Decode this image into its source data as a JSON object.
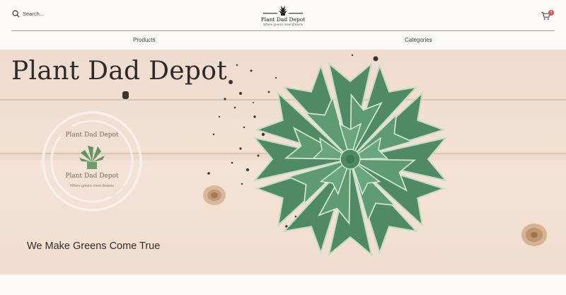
{
  "search": {
    "placeholder": "Search..."
  },
  "logo": {
    "name": "Plant Dad Depot",
    "tagline": "Where greens meet dreams"
  },
  "cart": {
    "count": "1"
  },
  "nav": {
    "products": "Products",
    "categories": "Categories"
  },
  "hero": {
    "title": "Plant Dad Depot",
    "tagline": "We Make Greens Come True",
    "badge_tagline": "Where greens meet dreams"
  },
  "colors": {
    "accent": "#d9534f",
    "succulent": "#5e9a72",
    "wood": "#f1e0d3"
  }
}
